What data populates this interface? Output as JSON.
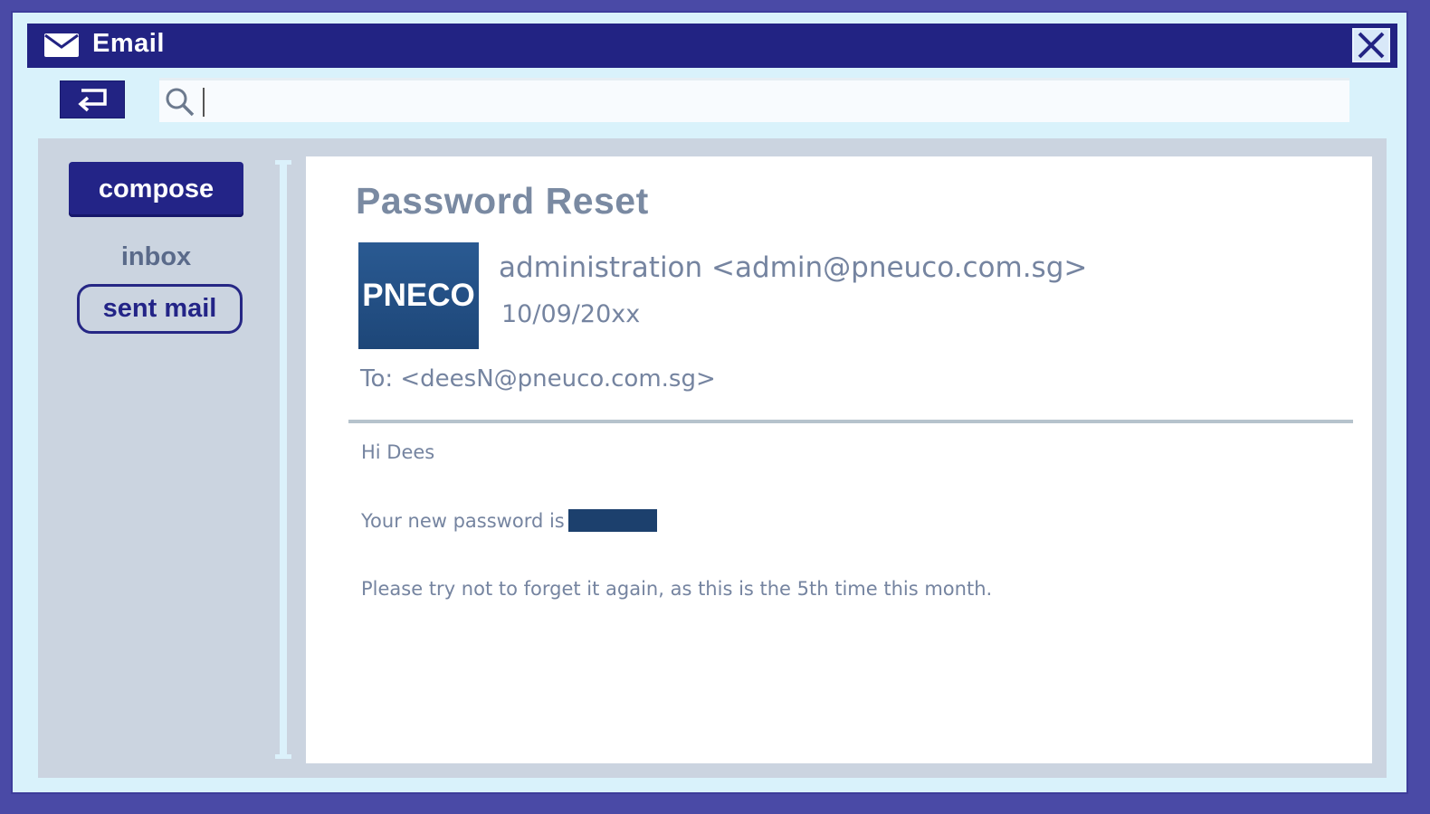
{
  "window": {
    "title": "Email",
    "icon": "envelope-icon",
    "close_icon": "close-icon"
  },
  "toolbar": {
    "back_icon": "return-arrow-icon",
    "search_icon": "search-icon",
    "search_value": ""
  },
  "sidebar": {
    "compose_label": "compose",
    "items": [
      {
        "label": "inbox",
        "selected": false
      },
      {
        "label": "sent mail",
        "selected": true
      }
    ]
  },
  "email": {
    "subject": "Password Reset",
    "logo_text": "PNECO",
    "sender": "administration <admin@pneuco.com.sg>",
    "date": "10/09/20xx",
    "recipient": "To: <deesN@pneuco.com.sg>",
    "body": {
      "greeting": "Hi Dees",
      "password_line": "Your new password is",
      "closing": "Please try not to forget it again, as this is the 5th time this month."
    }
  },
  "colors": {
    "titlebar": "#222383",
    "frame": "#4a4aa6",
    "accent_text": "#7584a0",
    "redaction": "#1c406d"
  }
}
